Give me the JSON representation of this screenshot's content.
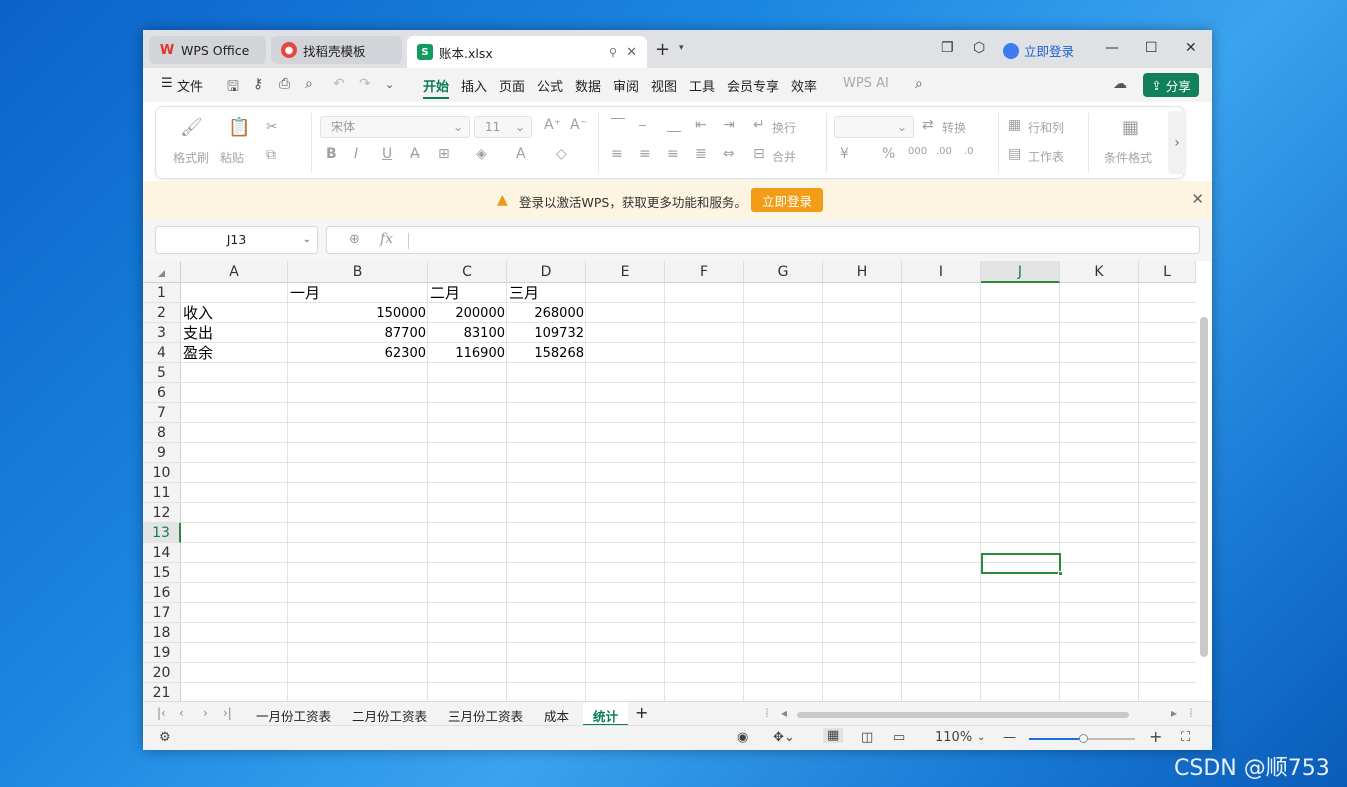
{
  "titlebar": {
    "tabs": [
      {
        "label": "WPS Office"
      },
      {
        "label": "找稻壳模板"
      },
      {
        "label": "账本.xlsx"
      }
    ],
    "login": "立即登录"
  },
  "menubar": {
    "file": "文件",
    "items": [
      "开始",
      "插入",
      "页面",
      "公式",
      "数据",
      "审阅",
      "视图",
      "工具",
      "会员专享",
      "效率"
    ],
    "wps_ai": "WPS AI",
    "share": "分享"
  },
  "ribbon": {
    "format_painter": "格式刷",
    "paste": "粘贴",
    "font_name": "宋体",
    "font_size": "11",
    "wrap": "换行",
    "merge": "合并",
    "convert": "转换",
    "rows_cols": "行和列",
    "worksheet": "工作表",
    "cond_format": "条件格式"
  },
  "notice": {
    "message": "登录以激活WPS，获取更多功能和服务。",
    "button": "立即登录"
  },
  "formula_bar": {
    "name_box": "J13",
    "fx": "fx",
    "formula": ""
  },
  "sheet": {
    "columns": [
      "A",
      "B",
      "C",
      "D",
      "E",
      "F",
      "G",
      "H",
      "I",
      "J",
      "K",
      "L"
    ],
    "rows": [
      "1",
      "2",
      "3",
      "4",
      "5",
      "6",
      "7",
      "8",
      "9",
      "10",
      "11",
      "12",
      "13",
      "14",
      "15",
      "16",
      "17",
      "18",
      "19",
      "20",
      "21"
    ],
    "cells": {
      "B1": "一月",
      "C1": "二月",
      "D1": "三月",
      "A2": "收入",
      "B2": "150000",
      "C2": "200000",
      "D2": "268000",
      "A3": "支出",
      "B3": "87700",
      "C3": "83100",
      "D3": "109732",
      "A4": "盈余",
      "B4": "62300",
      "C4": "116900",
      "D4": "158268"
    },
    "selected_cell": "J13"
  },
  "sheet_tabs": [
    "一月份工资表",
    "二月份工资表",
    "三月份工资表",
    "成本",
    "统计"
  ],
  "active_sheet": "统计",
  "status": {
    "zoom": "110%"
  },
  "watermark": "CSDN @顺753"
}
